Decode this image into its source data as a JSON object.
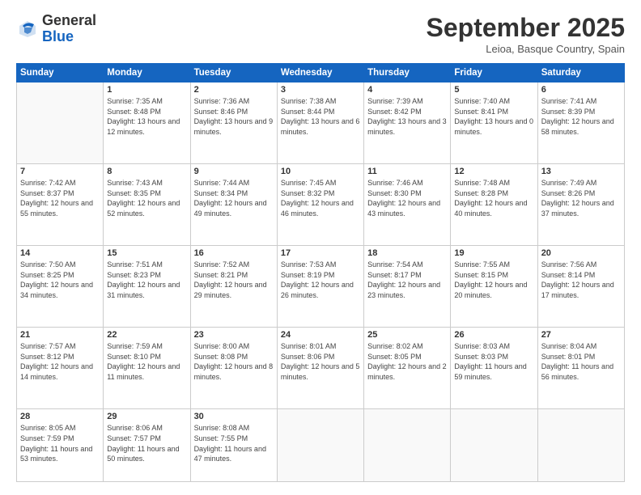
{
  "header": {
    "logo_general": "General",
    "logo_blue": "Blue",
    "month_title": "September 2025",
    "location": "Leioa, Basque Country, Spain"
  },
  "days_of_week": [
    "Sunday",
    "Monday",
    "Tuesday",
    "Wednesday",
    "Thursday",
    "Friday",
    "Saturday"
  ],
  "weeks": [
    [
      {
        "day": "",
        "sunrise": "",
        "sunset": "",
        "daylight": ""
      },
      {
        "day": "1",
        "sunrise": "Sunrise: 7:35 AM",
        "sunset": "Sunset: 8:48 PM",
        "daylight": "Daylight: 13 hours and 12 minutes."
      },
      {
        "day": "2",
        "sunrise": "Sunrise: 7:36 AM",
        "sunset": "Sunset: 8:46 PM",
        "daylight": "Daylight: 13 hours and 9 minutes."
      },
      {
        "day": "3",
        "sunrise": "Sunrise: 7:38 AM",
        "sunset": "Sunset: 8:44 PM",
        "daylight": "Daylight: 13 hours and 6 minutes."
      },
      {
        "day": "4",
        "sunrise": "Sunrise: 7:39 AM",
        "sunset": "Sunset: 8:42 PM",
        "daylight": "Daylight: 13 hours and 3 minutes."
      },
      {
        "day": "5",
        "sunrise": "Sunrise: 7:40 AM",
        "sunset": "Sunset: 8:41 PM",
        "daylight": "Daylight: 13 hours and 0 minutes."
      },
      {
        "day": "6",
        "sunrise": "Sunrise: 7:41 AM",
        "sunset": "Sunset: 8:39 PM",
        "daylight": "Daylight: 12 hours and 58 minutes."
      }
    ],
    [
      {
        "day": "7",
        "sunrise": "Sunrise: 7:42 AM",
        "sunset": "Sunset: 8:37 PM",
        "daylight": "Daylight: 12 hours and 55 minutes."
      },
      {
        "day": "8",
        "sunrise": "Sunrise: 7:43 AM",
        "sunset": "Sunset: 8:35 PM",
        "daylight": "Daylight: 12 hours and 52 minutes."
      },
      {
        "day": "9",
        "sunrise": "Sunrise: 7:44 AM",
        "sunset": "Sunset: 8:34 PM",
        "daylight": "Daylight: 12 hours and 49 minutes."
      },
      {
        "day": "10",
        "sunrise": "Sunrise: 7:45 AM",
        "sunset": "Sunset: 8:32 PM",
        "daylight": "Daylight: 12 hours and 46 minutes."
      },
      {
        "day": "11",
        "sunrise": "Sunrise: 7:46 AM",
        "sunset": "Sunset: 8:30 PM",
        "daylight": "Daylight: 12 hours and 43 minutes."
      },
      {
        "day": "12",
        "sunrise": "Sunrise: 7:48 AM",
        "sunset": "Sunset: 8:28 PM",
        "daylight": "Daylight: 12 hours and 40 minutes."
      },
      {
        "day": "13",
        "sunrise": "Sunrise: 7:49 AM",
        "sunset": "Sunset: 8:26 PM",
        "daylight": "Daylight: 12 hours and 37 minutes."
      }
    ],
    [
      {
        "day": "14",
        "sunrise": "Sunrise: 7:50 AM",
        "sunset": "Sunset: 8:25 PM",
        "daylight": "Daylight: 12 hours and 34 minutes."
      },
      {
        "day": "15",
        "sunrise": "Sunrise: 7:51 AM",
        "sunset": "Sunset: 8:23 PM",
        "daylight": "Daylight: 12 hours and 31 minutes."
      },
      {
        "day": "16",
        "sunrise": "Sunrise: 7:52 AM",
        "sunset": "Sunset: 8:21 PM",
        "daylight": "Daylight: 12 hours and 29 minutes."
      },
      {
        "day": "17",
        "sunrise": "Sunrise: 7:53 AM",
        "sunset": "Sunset: 8:19 PM",
        "daylight": "Daylight: 12 hours and 26 minutes."
      },
      {
        "day": "18",
        "sunrise": "Sunrise: 7:54 AM",
        "sunset": "Sunset: 8:17 PM",
        "daylight": "Daylight: 12 hours and 23 minutes."
      },
      {
        "day": "19",
        "sunrise": "Sunrise: 7:55 AM",
        "sunset": "Sunset: 8:15 PM",
        "daylight": "Daylight: 12 hours and 20 minutes."
      },
      {
        "day": "20",
        "sunrise": "Sunrise: 7:56 AM",
        "sunset": "Sunset: 8:14 PM",
        "daylight": "Daylight: 12 hours and 17 minutes."
      }
    ],
    [
      {
        "day": "21",
        "sunrise": "Sunrise: 7:57 AM",
        "sunset": "Sunset: 8:12 PM",
        "daylight": "Daylight: 12 hours and 14 minutes."
      },
      {
        "day": "22",
        "sunrise": "Sunrise: 7:59 AM",
        "sunset": "Sunset: 8:10 PM",
        "daylight": "Daylight: 12 hours and 11 minutes."
      },
      {
        "day": "23",
        "sunrise": "Sunrise: 8:00 AM",
        "sunset": "Sunset: 8:08 PM",
        "daylight": "Daylight: 12 hours and 8 minutes."
      },
      {
        "day": "24",
        "sunrise": "Sunrise: 8:01 AM",
        "sunset": "Sunset: 8:06 PM",
        "daylight": "Daylight: 12 hours and 5 minutes."
      },
      {
        "day": "25",
        "sunrise": "Sunrise: 8:02 AM",
        "sunset": "Sunset: 8:05 PM",
        "daylight": "Daylight: 12 hours and 2 minutes."
      },
      {
        "day": "26",
        "sunrise": "Sunrise: 8:03 AM",
        "sunset": "Sunset: 8:03 PM",
        "daylight": "Daylight: 11 hours and 59 minutes."
      },
      {
        "day": "27",
        "sunrise": "Sunrise: 8:04 AM",
        "sunset": "Sunset: 8:01 PM",
        "daylight": "Daylight: 11 hours and 56 minutes."
      }
    ],
    [
      {
        "day": "28",
        "sunrise": "Sunrise: 8:05 AM",
        "sunset": "Sunset: 7:59 PM",
        "daylight": "Daylight: 11 hours and 53 minutes."
      },
      {
        "day": "29",
        "sunrise": "Sunrise: 8:06 AM",
        "sunset": "Sunset: 7:57 PM",
        "daylight": "Daylight: 11 hours and 50 minutes."
      },
      {
        "day": "30",
        "sunrise": "Sunrise: 8:08 AM",
        "sunset": "Sunset: 7:55 PM",
        "daylight": "Daylight: 11 hours and 47 minutes."
      },
      {
        "day": "",
        "sunrise": "",
        "sunset": "",
        "daylight": ""
      },
      {
        "day": "",
        "sunrise": "",
        "sunset": "",
        "daylight": ""
      },
      {
        "day": "",
        "sunrise": "",
        "sunset": "",
        "daylight": ""
      },
      {
        "day": "",
        "sunrise": "",
        "sunset": "",
        "daylight": ""
      }
    ]
  ]
}
